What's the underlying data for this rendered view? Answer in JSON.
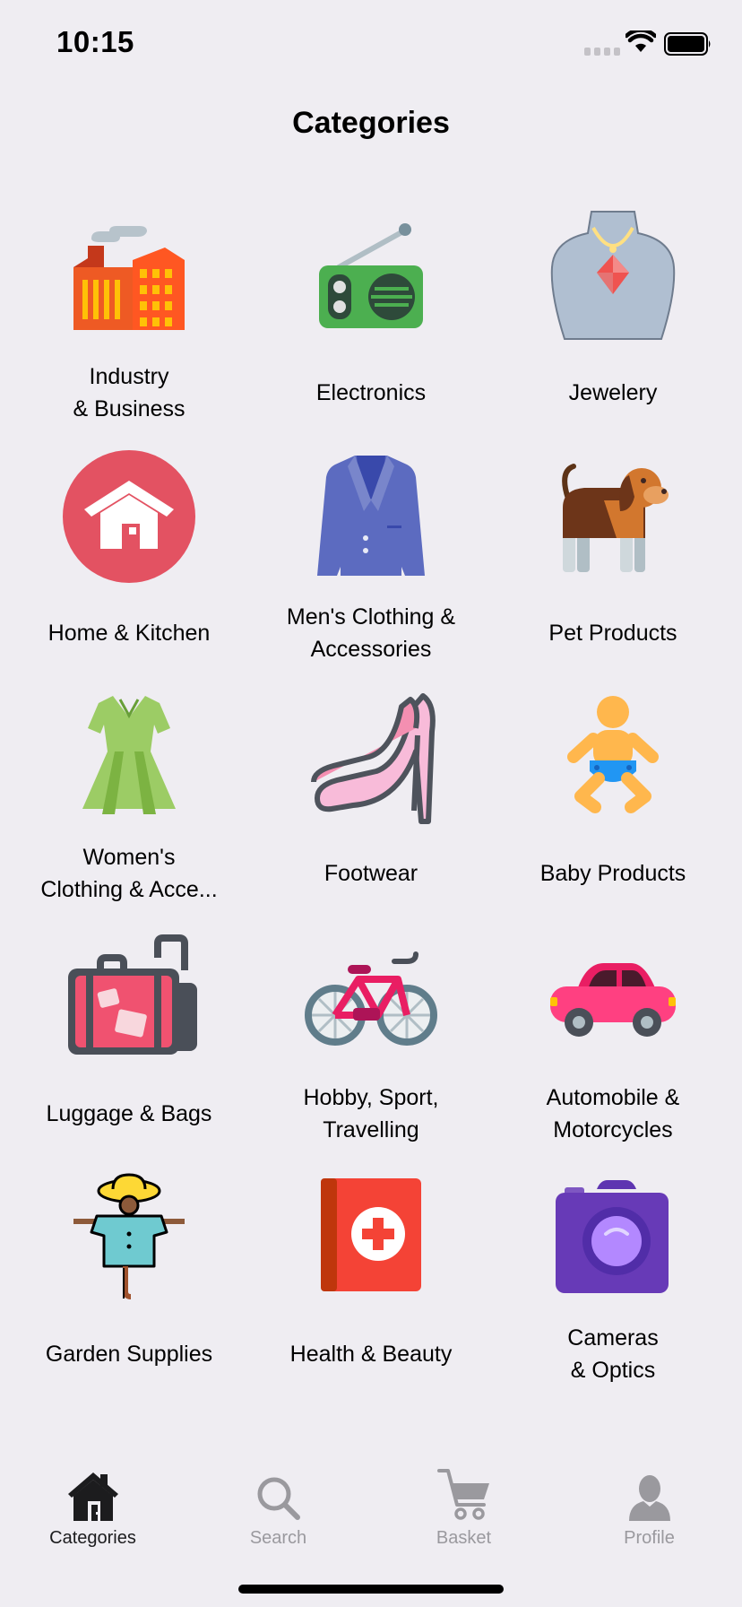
{
  "status_bar": {
    "time": "10:15"
  },
  "header": {
    "title": "Categories"
  },
  "categories": [
    {
      "label": "Industry\n& Business",
      "icon": "factory-icon"
    },
    {
      "label": "Electronics",
      "icon": "radio-icon"
    },
    {
      "label": "Jewelery",
      "icon": "necklace-icon"
    },
    {
      "label": "Home & Kitchen",
      "icon": "house-icon"
    },
    {
      "label": "Men's Clothing &\nAccessories",
      "icon": "blazer-icon"
    },
    {
      "label": "Pet Products",
      "icon": "dog-icon"
    },
    {
      "label": "Women's\nClothing & Acce...",
      "icon": "dress-icon"
    },
    {
      "label": "Footwear",
      "icon": "high-heels-icon"
    },
    {
      "label": "Baby Products",
      "icon": "baby-icon"
    },
    {
      "label": "Luggage & Bags",
      "icon": "luggage-icon"
    },
    {
      "label": "Hobby, Sport,\nTravelling",
      "icon": "bicycle-icon"
    },
    {
      "label": "Automobile &\nMotorcycles",
      "icon": "car-icon"
    },
    {
      "label": "Garden Supplies",
      "icon": "scarecrow-icon"
    },
    {
      "label": "Health & Beauty",
      "icon": "first-aid-book-icon"
    },
    {
      "label": "Cameras\n& Optics",
      "icon": "camera-icon"
    }
  ],
  "tab_bar": {
    "tabs": [
      {
        "label": "Categories",
        "icon": "home-icon",
        "active": true
      },
      {
        "label": "Search",
        "icon": "search-icon",
        "active": false
      },
      {
        "label": "Basket",
        "icon": "cart-icon",
        "active": false
      },
      {
        "label": "Profile",
        "icon": "person-icon",
        "active": false
      }
    ]
  },
  "colors": {
    "background": "#efedf2",
    "active_tab": "#1c1c1e",
    "inactive_tab": "#9a999e"
  }
}
